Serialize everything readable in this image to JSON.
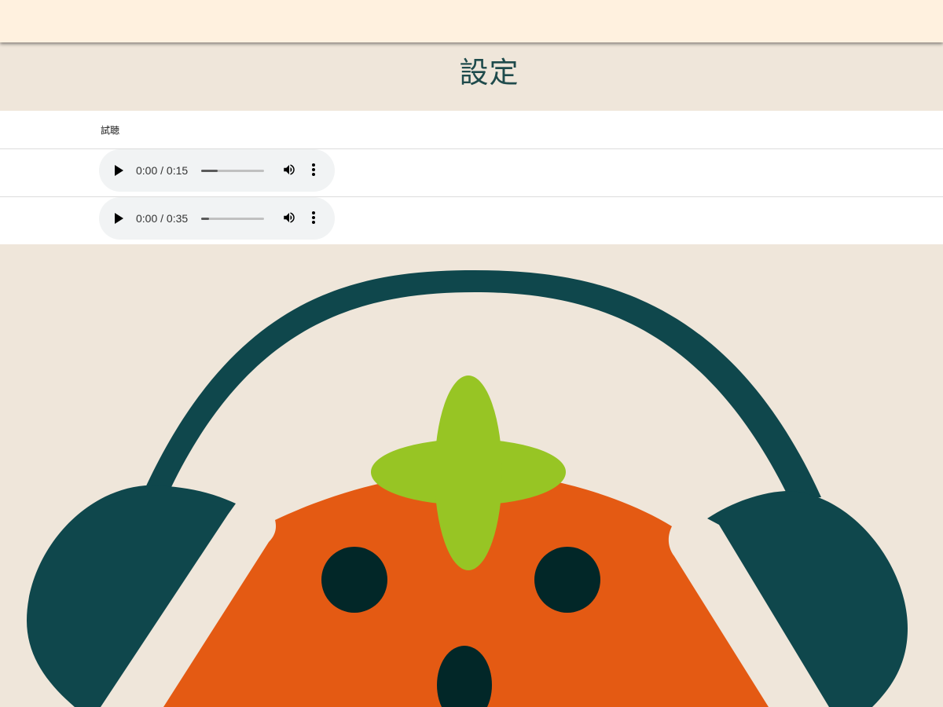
{
  "header": {
    "title": "設定"
  },
  "preview": {
    "section_label": "試聴",
    "players": [
      {
        "time": "0:00 / 0:15",
        "progress_percent": 26
      },
      {
        "time": "0:00 / 0:35",
        "progress_percent": 12
      }
    ]
  },
  "icons": {
    "play": "play-icon",
    "volume": "volume-icon",
    "more": "more-vertical-icon"
  },
  "colors": {
    "topbar": "#fff1df",
    "background": "#efe6da",
    "headphones": "#0f474c",
    "face": "#e45a13",
    "leaf": "#97c524",
    "eyes": "#022728"
  }
}
